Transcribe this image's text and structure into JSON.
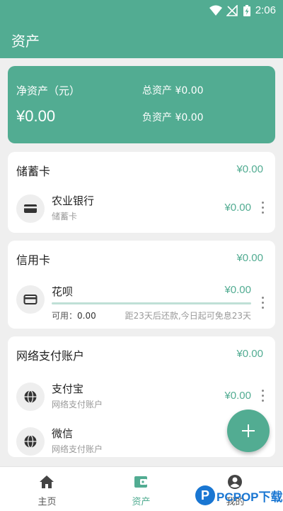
{
  "status_bar": {
    "time": "2:06",
    "icons": [
      "wifi-icon",
      "no-signal-icon",
      "battery-charging-icon"
    ]
  },
  "app_bar": {
    "title": "资产"
  },
  "summary": {
    "net_label": "净资产（元）",
    "net_value": "¥0.00",
    "total_assets": "总资产 ¥0.00",
    "liabilities": "负资产 ¥0.00"
  },
  "groups": {
    "debit": {
      "title": "储蓄卡",
      "total": "¥0.00",
      "accounts": [
        {
          "name": "农业银行",
          "type": "储蓄卡",
          "amount": "¥0.00",
          "icon": "wallet-icon"
        }
      ]
    },
    "credit": {
      "title": "信用卡",
      "total": "¥0.00",
      "accounts": [
        {
          "name": "花呗",
          "amount": "¥0.00",
          "available_label": "可用：",
          "available_value": "0.00",
          "due_text": "距23天后还款,今日起可免息23天",
          "icon": "credit-card-icon"
        }
      ]
    },
    "online": {
      "title": "网络支付账户",
      "total": "¥0.00",
      "accounts": [
        {
          "name": "支付宝",
          "type": "网络支付账户",
          "amount": "¥0.00",
          "icon": "globe-icon"
        },
        {
          "name": "微信",
          "type": "网络支付账户",
          "amount": "¥",
          "icon": "globe-icon"
        }
      ]
    }
  },
  "fab": {
    "icon": "plus-icon"
  },
  "bottom_nav": [
    {
      "label": "主页",
      "icon": "home-icon",
      "active": false
    },
    {
      "label": "资产",
      "icon": "wallet-icon",
      "active": true
    },
    {
      "label": "我的",
      "icon": "user-icon",
      "active": false
    }
  ],
  "watermark": {
    "logo": "P",
    "text": "PCPOP下载"
  },
  "colors": {
    "accent": "#52ac92",
    "background": "#efefef",
    "card": "#ffffff"
  }
}
